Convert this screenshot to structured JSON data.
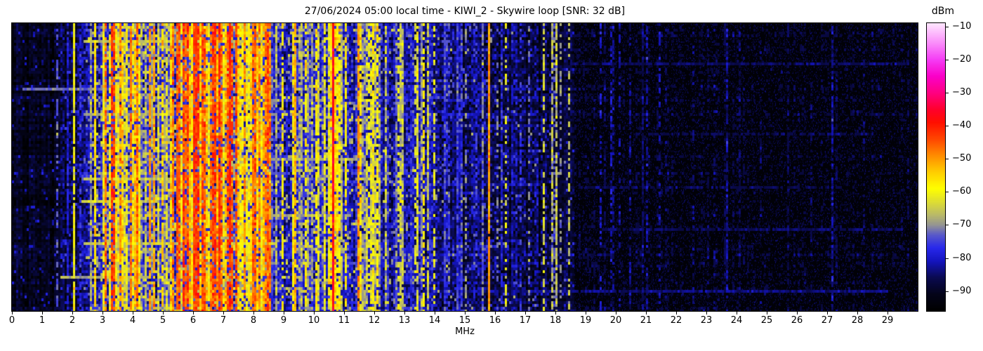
{
  "title": "27/06/2024 05:00 local time - KIWI_2 - Skywire loop [SNR: 32 dB]",
  "xlabel": "MHz",
  "colorbar_unit": "dBm",
  "chart_data": {
    "type": "heatmap",
    "title": "27/06/2024 05:00 local time - KIWI_2 - Skywire loop [SNR: 32 dB]",
    "xlabel": "MHz",
    "x_range": [
      0,
      30
    ],
    "x_ticks": [
      0,
      1,
      2,
      3,
      4,
      5,
      6,
      7,
      8,
      9,
      10,
      11,
      12,
      13,
      14,
      15,
      16,
      17,
      18,
      19,
      20,
      21,
      22,
      23,
      24,
      25,
      26,
      27,
      28,
      29
    ],
    "y_axis": "time (no ticks shown)",
    "grid": false,
    "value_label": "dBm",
    "value_range": [
      -96,
      -9
    ],
    "colorbar_ticks": [
      {
        "v": -10,
        "label": "−10"
      },
      {
        "v": -20,
        "label": "−20"
      },
      {
        "v": -30,
        "label": "−30"
      },
      {
        "v": -40,
        "label": "−40"
      },
      {
        "v": -50,
        "label": "−50"
      },
      {
        "v": -60,
        "label": "−60"
      },
      {
        "v": -70,
        "label": "−70"
      },
      {
        "v": -80,
        "label": "−80"
      },
      {
        "v": -90,
        "label": "−90"
      }
    ],
    "colormap_stops": [
      [
        -96,
        "#000000"
      ],
      [
        -91,
        "#04041a"
      ],
      [
        -86,
        "#0a0a50"
      ],
      [
        -81,
        "#1414be"
      ],
      [
        -77,
        "#2828eb"
      ],
      [
        -73,
        "#5a5ac8"
      ],
      [
        -70,
        "#969691"
      ],
      [
        -67,
        "#b9b969"
      ],
      [
        -63,
        "#dede32"
      ],
      [
        -59,
        "#ffff00"
      ],
      [
        -54,
        "#ffcd00"
      ],
      [
        -49,
        "#ff8c00"
      ],
      [
        -44,
        "#ff4600"
      ],
      [
        -39,
        "#ff0f00"
      ],
      [
        -35,
        "#ff002d"
      ],
      [
        -30,
        "#ff0082"
      ],
      [
        -25,
        "#fa00c8"
      ],
      [
        -20,
        "#f53cf5"
      ],
      [
        -15,
        "#fa8cfa"
      ],
      [
        -9,
        "#ffe6ff"
      ]
    ],
    "noise_floor_dbm": [
      [
        0.0,
        -92
      ],
      [
        1.4,
        -91
      ],
      [
        1.6,
        -88
      ],
      [
        2.3,
        -87
      ],
      [
        2.5,
        -82
      ],
      [
        3.0,
        -79
      ],
      [
        3.2,
        -77
      ],
      [
        8.5,
        -76
      ],
      [
        8.7,
        -79
      ],
      [
        10.5,
        -79
      ],
      [
        12.0,
        -81
      ],
      [
        13.5,
        -83
      ],
      [
        14.5,
        -85
      ],
      [
        16.0,
        -86.5
      ],
      [
        18.0,
        -88
      ],
      [
        18.7,
        -90.5
      ],
      [
        20.0,
        -91.5
      ],
      [
        30.0,
        -92
      ]
    ],
    "active_bands": [
      {
        "from": 2.45,
        "to": 3.1,
        "stripe_density": 0.45,
        "stripe_dbm": [
          -74,
          -58
        ],
        "speckle": 0.22
      },
      {
        "from": 3.1,
        "to": 4.3,
        "stripe_density": 0.72,
        "stripe_dbm": [
          -66,
          -46
        ],
        "speckle": 0.3
      },
      {
        "from": 4.3,
        "to": 5.2,
        "stripe_density": 0.6,
        "stripe_dbm": [
          -70,
          -50
        ],
        "speckle": 0.28
      },
      {
        "from": 5.2,
        "to": 8.55,
        "stripe_density": 0.8,
        "stripe_dbm": [
          -62,
          -42
        ],
        "speckle": 0.32
      },
      {
        "from": 8.7,
        "to": 12.0,
        "stripe_density": 0.33,
        "stripe_dbm": [
          -70,
          -52
        ],
        "speckle": 0.15
      },
      {
        "from": 12.0,
        "to": 14.2,
        "stripe_density": 0.2,
        "stripe_dbm": [
          -74,
          -58
        ],
        "speckle": 0.1
      },
      {
        "from": 14.2,
        "to": 16.0,
        "stripe_density": 0.12,
        "stripe_dbm": [
          -80,
          -64
        ],
        "speckle": 0.08
      },
      {
        "from": 16.0,
        "to": 18.6,
        "stripe_density": 0.12,
        "stripe_dbm": [
          -82,
          -66
        ],
        "speckle": 0.06
      },
      {
        "from": 18.6,
        "to": 30.0,
        "stripe_density": 0.045,
        "stripe_dbm": [
          -87,
          -82
        ],
        "speckle": 0.0
      }
    ],
    "carriers": [
      {
        "mhz": 1.53,
        "dbm": -73,
        "duty": 0.55
      },
      {
        "mhz": 1.88,
        "dbm": -79,
        "duty": 0.8
      },
      {
        "mhz": 2.09,
        "dbm": -60,
        "duty": 0.95
      },
      {
        "mhz": 2.25,
        "dbm": -78,
        "duty": 0.7
      },
      {
        "mhz": 2.75,
        "dbm": -56,
        "duty": 0.9
      },
      {
        "mhz": 3.3,
        "dbm": -43,
        "duty": 0.75,
        "w": 2
      },
      {
        "mhz": 3.6,
        "dbm": -50,
        "duty": 0.8
      },
      {
        "mhz": 3.95,
        "dbm": -48,
        "duty": 0.85
      },
      {
        "mhz": 4.6,
        "dbm": -50,
        "duty": 0.8
      },
      {
        "mhz": 5.0,
        "dbm": -55,
        "duty": 0.8
      },
      {
        "mhz": 5.45,
        "dbm": -45,
        "duty": 0.85
      },
      {
        "mhz": 5.75,
        "dbm": -48,
        "duty": 0.8
      },
      {
        "mhz": 6.05,
        "dbm": -43,
        "duty": 0.9,
        "w": 2
      },
      {
        "mhz": 6.3,
        "dbm": -45,
        "duty": 0.85
      },
      {
        "mhz": 6.62,
        "dbm": -47,
        "duty": 0.8
      },
      {
        "mhz": 6.9,
        "dbm": -42,
        "duty": 0.85
      },
      {
        "mhz": 7.2,
        "dbm": -41,
        "duty": 0.9
      },
      {
        "mhz": 7.45,
        "dbm": -44,
        "duty": 0.85
      },
      {
        "mhz": 7.7,
        "dbm": -50,
        "duty": 0.8
      },
      {
        "mhz": 8.0,
        "dbm": -47,
        "duty": 0.8
      },
      {
        "mhz": 8.35,
        "dbm": -52,
        "duty": 0.85
      },
      {
        "mhz": 8.95,
        "dbm": -58,
        "duty": 0.7
      },
      {
        "mhz": 9.35,
        "dbm": -52,
        "duty": 0.85
      },
      {
        "mhz": 9.75,
        "dbm": -58,
        "duty": 0.7
      },
      {
        "mhz": 10.05,
        "dbm": -57,
        "duty": 0.75
      },
      {
        "mhz": 10.62,
        "dbm": -37,
        "duty": 0.97
      },
      {
        "mhz": 11.08,
        "dbm": -58,
        "duty": 0.7
      },
      {
        "mhz": 11.5,
        "dbm": -49,
        "duty": 0.9
      },
      {
        "mhz": 11.85,
        "dbm": -60,
        "duty": 0.6
      },
      {
        "mhz": 12.12,
        "dbm": -58,
        "duty": 0.7
      },
      {
        "mhz": 12.8,
        "dbm": -63,
        "duty": 0.5
      },
      {
        "mhz": 13.35,
        "dbm": -64,
        "duty": 0.5
      },
      {
        "mhz": 13.62,
        "dbm": -58,
        "duty": 0.7
      },
      {
        "mhz": 14.0,
        "dbm": -62,
        "duty": 0.6
      },
      {
        "mhz": 14.45,
        "dbm": -74,
        "duty": 0.5
      },
      {
        "mhz": 15.0,
        "dbm": -70,
        "duty": 0.45
      },
      {
        "mhz": 15.35,
        "dbm": -76,
        "duty": 0.5
      },
      {
        "mhz": 15.78,
        "dbm": -50,
        "duty": 0.98
      },
      {
        "mhz": 16.1,
        "dbm": -72,
        "duty": 0.4
      },
      {
        "mhz": 16.38,
        "dbm": -62,
        "duty": 0.45
      },
      {
        "mhz": 16.85,
        "dbm": -76,
        "duty": 0.5
      },
      {
        "mhz": 17.12,
        "dbm": -72,
        "duty": 0.45
      },
      {
        "mhz": 17.6,
        "dbm": -64,
        "duty": 0.5
      },
      {
        "mhz": 17.95,
        "dbm": -74,
        "duty": 0.4
      },
      {
        "mhz": 18.2,
        "dbm": -70,
        "duty": 0.45
      },
      {
        "mhz": 18.45,
        "dbm": -66,
        "duty": 0.5
      },
      {
        "mhz": 19.5,
        "dbm": -80,
        "duty": 0.4
      },
      {
        "mhz": 19.85,
        "dbm": -82,
        "duty": 0.6
      },
      {
        "mhz": 20.15,
        "dbm": -82,
        "duty": 0.4
      },
      {
        "mhz": 21.05,
        "dbm": -83,
        "duty": 0.6
      },
      {
        "mhz": 21.45,
        "dbm": -82,
        "duty": 0.4
      },
      {
        "mhz": 22.6,
        "dbm": -86,
        "duty": 0.4
      },
      {
        "mhz": 23.3,
        "dbm": -85,
        "duty": 0.35
      },
      {
        "mhz": 24.8,
        "dbm": -86,
        "duty": 0.3
      },
      {
        "mhz": 26.5,
        "dbm": -86,
        "duty": 0.3
      },
      {
        "mhz": 28.2,
        "dbm": -86,
        "duty": 0.3
      }
    ],
    "time_events": [
      {
        "row": 0.06,
        "from": 2.4,
        "to": 8.6,
        "dbm": -66
      },
      {
        "row": 0.225,
        "from": 0.35,
        "to": 8.7,
        "dbm": -72
      },
      {
        "row": 0.31,
        "from": 2.4,
        "to": 5.2,
        "dbm": -68
      },
      {
        "row": 0.35,
        "from": 12.0,
        "to": 18.0,
        "dbm": -84
      },
      {
        "row": 0.47,
        "from": 8.5,
        "to": 11.5,
        "dbm": -70
      },
      {
        "row": 0.535,
        "from": 2.4,
        "to": 8.6,
        "dbm": -67
      },
      {
        "row": 0.56,
        "from": 12.5,
        "to": 17.5,
        "dbm": -83
      },
      {
        "row": 0.62,
        "from": 2.3,
        "to": 4.8,
        "dbm": -64
      },
      {
        "row": 0.665,
        "from": 8.5,
        "to": 11.2,
        "dbm": -69
      },
      {
        "row": 0.76,
        "from": 2.4,
        "to": 8.7,
        "dbm": -66
      },
      {
        "row": 0.88,
        "from": 1.6,
        "to": 4.6,
        "dbm": -68
      },
      {
        "row": 0.14,
        "from": 18.5,
        "to": 29.8,
        "dbm": -86
      },
      {
        "row": 0.38,
        "from": 20.5,
        "to": 28.5,
        "dbm": -87
      },
      {
        "row": 0.565,
        "from": 18.8,
        "to": 27.5,
        "dbm": -87
      },
      {
        "row": 0.72,
        "from": 19.5,
        "to": 29.5,
        "dbm": -86
      },
      {
        "row": 0.93,
        "from": 14.0,
        "to": 29.0,
        "dbm": -84
      }
    ],
    "seed": 1234
  }
}
